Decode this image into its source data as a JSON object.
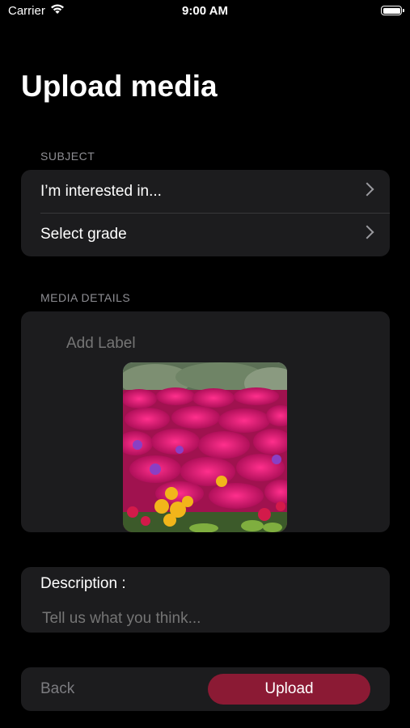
{
  "status_bar": {
    "carrier": "Carrier",
    "time": "9:00 AM"
  },
  "page": {
    "title": "Upload media"
  },
  "subject": {
    "section_label": "SUBJECT",
    "rows": [
      {
        "label": "I’m interested in..."
      },
      {
        "label": "Select grade"
      }
    ]
  },
  "media_details": {
    "section_label": "MEDIA DETAILS",
    "label_placeholder": "Add Label"
  },
  "description": {
    "title": "Description :",
    "placeholder": "Tell us what you think..."
  },
  "actions": {
    "back": "Back",
    "upload": "Upload"
  },
  "colors": {
    "background": "#000000",
    "card": "#1c1c1e",
    "upload_button": "#8b1a34",
    "secondary_text": "#8e8e93"
  }
}
